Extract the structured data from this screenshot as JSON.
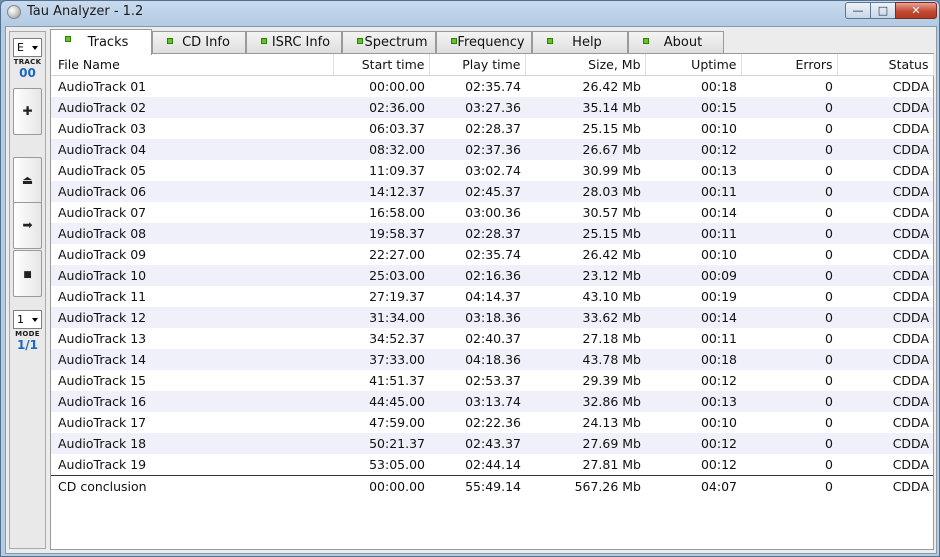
{
  "window": {
    "title": "Tau Analyzer - 1.2",
    "buttons": {
      "minimize": "—",
      "maximize": "□",
      "close": "✕"
    }
  },
  "toolbar": {
    "drive_select": "E",
    "track_label": "TRACK",
    "track_number": "00",
    "add_glyph": "✚",
    "eject_glyph": "⏏",
    "play_glyph": "➡",
    "stop_glyph": "■",
    "mode_select": "1",
    "mode_label": "MODE",
    "mode_value": "1/1"
  },
  "tabs": [
    {
      "label": "Tracks",
      "active": true
    },
    {
      "label": "CD Info",
      "active": false
    },
    {
      "label": "ISRC Info",
      "active": false
    },
    {
      "label": "Spectrum",
      "active": false
    },
    {
      "label": "Frequency",
      "active": false
    },
    {
      "label": "Help",
      "active": false
    },
    {
      "label": "About",
      "active": false
    }
  ],
  "table": {
    "columns": [
      "File Name",
      "Start time",
      "Play time",
      "Size, Mb",
      "Uptime",
      "Errors",
      "Status"
    ],
    "rows": [
      [
        "AudioTrack 01",
        "00:00.00",
        "02:35.74",
        "26.42 Mb",
        "00:18",
        "0",
        "CDDA"
      ],
      [
        "AudioTrack 02",
        "02:36.00",
        "03:27.36",
        "35.14 Mb",
        "00:15",
        "0",
        "CDDA"
      ],
      [
        "AudioTrack 03",
        "06:03.37",
        "02:28.37",
        "25.15 Mb",
        "00:10",
        "0",
        "CDDA"
      ],
      [
        "AudioTrack 04",
        "08:32.00",
        "02:37.36",
        "26.67 Mb",
        "00:12",
        "0",
        "CDDA"
      ],
      [
        "AudioTrack 05",
        "11:09.37",
        "03:02.74",
        "30.99 Mb",
        "00:13",
        "0",
        "CDDA"
      ],
      [
        "AudioTrack 06",
        "14:12.37",
        "02:45.37",
        "28.03 Mb",
        "00:11",
        "0",
        "CDDA"
      ],
      [
        "AudioTrack 07",
        "16:58.00",
        "03:00.36",
        "30.57 Mb",
        "00:14",
        "0",
        "CDDA"
      ],
      [
        "AudioTrack 08",
        "19:58.37",
        "02:28.37",
        "25.15 Mb",
        "00:11",
        "0",
        "CDDA"
      ],
      [
        "AudioTrack 09",
        "22:27.00",
        "02:35.74",
        "26.42 Mb",
        "00:10",
        "0",
        "CDDA"
      ],
      [
        "AudioTrack 10",
        "25:03.00",
        "02:16.36",
        "23.12 Mb",
        "00:09",
        "0",
        "CDDA"
      ],
      [
        "AudioTrack 11",
        "27:19.37",
        "04:14.37",
        "43.10 Mb",
        "00:19",
        "0",
        "CDDA"
      ],
      [
        "AudioTrack 12",
        "31:34.00",
        "03:18.36",
        "33.62 Mb",
        "00:14",
        "0",
        "CDDA"
      ],
      [
        "AudioTrack 13",
        "34:52.37",
        "02:40.37",
        "27.18 Mb",
        "00:11",
        "0",
        "CDDA"
      ],
      [
        "AudioTrack 14",
        "37:33.00",
        "04:18.36",
        "43.78 Mb",
        "00:18",
        "0",
        "CDDA"
      ],
      [
        "AudioTrack 15",
        "41:51.37",
        "02:53.37",
        "29.39 Mb",
        "00:12",
        "0",
        "CDDA"
      ],
      [
        "AudioTrack 16",
        "44:45.00",
        "03:13.74",
        "32.86 Mb",
        "00:13",
        "0",
        "CDDA"
      ],
      [
        "AudioTrack 17",
        "47:59.00",
        "02:22.36",
        "24.13 Mb",
        "00:10",
        "0",
        "CDDA"
      ],
      [
        "AudioTrack 18",
        "50:21.37",
        "02:43.37",
        "27.69 Mb",
        "00:12",
        "0",
        "CDDA"
      ],
      [
        "AudioTrack 19",
        "53:05.00",
        "02:44.14",
        "27.81 Mb",
        "00:12",
        "0",
        "CDDA"
      ]
    ],
    "summary": [
      "CD conclusion",
      "00:00.00",
      "55:49.14",
      "567.26 Mb",
      "04:07",
      "0",
      "CDDA"
    ]
  }
}
